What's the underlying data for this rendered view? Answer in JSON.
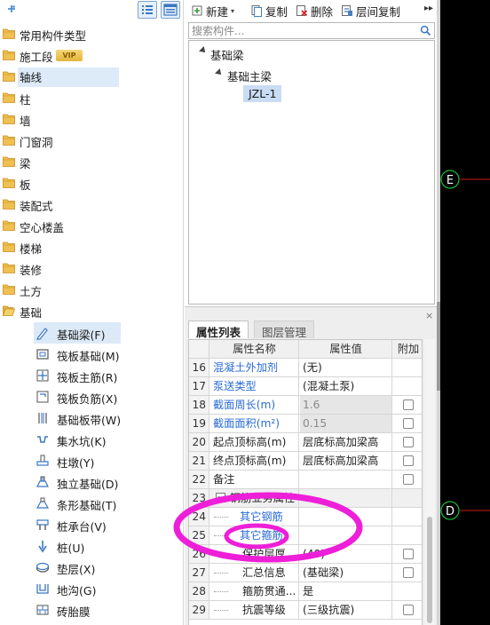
{
  "left_panel": {
    "categories": [
      {
        "label": "常用构件类型"
      },
      {
        "label": "施工段",
        "badge": "VIP"
      },
      {
        "label": "轴线"
      },
      {
        "label": "柱"
      },
      {
        "label": "墙"
      },
      {
        "label": "门窗洞"
      },
      {
        "label": "梁"
      },
      {
        "label": "板"
      },
      {
        "label": "装配式"
      },
      {
        "label": "空心楼盖"
      },
      {
        "label": "楼梯"
      },
      {
        "label": "装修"
      },
      {
        "label": "土方"
      },
      {
        "label": "基础"
      }
    ],
    "sub_items": [
      {
        "label": "基础梁(F)",
        "icon": "beam-pencil-icon"
      },
      {
        "label": "筏板基础(M)",
        "icon": "raft-foundation-icon"
      },
      {
        "label": "筏板主筋(R)",
        "icon": "raft-main-rebar-icon"
      },
      {
        "label": "筏板负筋(X)",
        "icon": "raft-negative-rebar-icon"
      },
      {
        "label": "基础板带(W)",
        "icon": "foundation-strip-icon"
      },
      {
        "label": "集水坑(K)",
        "icon": "sump-pit-icon"
      },
      {
        "label": "柱墩(Y)",
        "icon": "column-pier-icon"
      },
      {
        "label": "独立基础(D)",
        "icon": "isolated-footing-icon"
      },
      {
        "label": "条形基础(T)",
        "icon": "strip-footing-icon"
      },
      {
        "label": "桩承台(V)",
        "icon": "pile-cap-icon"
      },
      {
        "label": "桩(U)",
        "icon": "pile-icon"
      },
      {
        "label": "垫层(X)",
        "icon": "cushion-layer-icon"
      },
      {
        "label": "地沟(G)",
        "icon": "trench-icon"
      },
      {
        "label": "砖胎膜",
        "icon": "brick-mold-icon"
      }
    ]
  },
  "toolbar": {
    "new_label": "新建",
    "copy_label": "复制",
    "delete_label": "删除",
    "floor_copy_label": "层间复制",
    "more": "▸▸"
  },
  "search": {
    "placeholder": "搜索构件..."
  },
  "component_tree": {
    "root": "基础梁",
    "child": "基础主梁",
    "leaf": "JZL-1"
  },
  "properties": {
    "close": "×",
    "tabs": [
      "属性列表",
      "图层管理"
    ],
    "columns": [
      "属性名称",
      "属性值",
      "附加"
    ],
    "rows": [
      {
        "num": "16",
        "name": "混凝土外加剂",
        "value": "(无)",
        "checkbox": false
      },
      {
        "num": "17",
        "name": "泵送类型",
        "value": "(混凝土泵)",
        "checkbox": false
      },
      {
        "num": "18",
        "name": "截面周长(m)",
        "value": "1.6",
        "checkbox": true
      },
      {
        "num": "19",
        "name": "截面面积(m²)",
        "value": "0.15",
        "checkbox": true
      },
      {
        "num": "20",
        "name": "起点顶标高(m)",
        "value": "层底标高加梁高",
        "checkbox": true
      },
      {
        "num": "21",
        "name": "终点顶标高(m)",
        "value": "层底标高加梁高",
        "checkbox": true
      },
      {
        "num": "22",
        "name": "备注",
        "value": "",
        "checkbox": true
      },
      {
        "num": "23",
        "name": "钢筋业务属性",
        "value": "",
        "checkbox": false
      },
      {
        "num": "24",
        "name": "其它钢筋",
        "value": "",
        "checkbox": false
      },
      {
        "num": "25",
        "name": "其它箍筋",
        "value": "",
        "checkbox": false
      },
      {
        "num": "26",
        "name": "保护层厚...",
        "value": "(40)",
        "checkbox": true
      },
      {
        "num": "27",
        "name": "汇总信息",
        "value": "(基础梁)",
        "checkbox": true
      },
      {
        "num": "28",
        "name": "箍筋贯通...",
        "value": "是",
        "checkbox": false
      },
      {
        "num": "29",
        "name": "抗震等级",
        "value": "(三级抗震)",
        "checkbox": true
      }
    ]
  },
  "canvas": {
    "axis_labels": [
      "E",
      "D"
    ],
    "axis_color": "#d01818",
    "bubble_color": "#19c03a"
  },
  "annotation": {
    "color": "#ee1fd8"
  }
}
